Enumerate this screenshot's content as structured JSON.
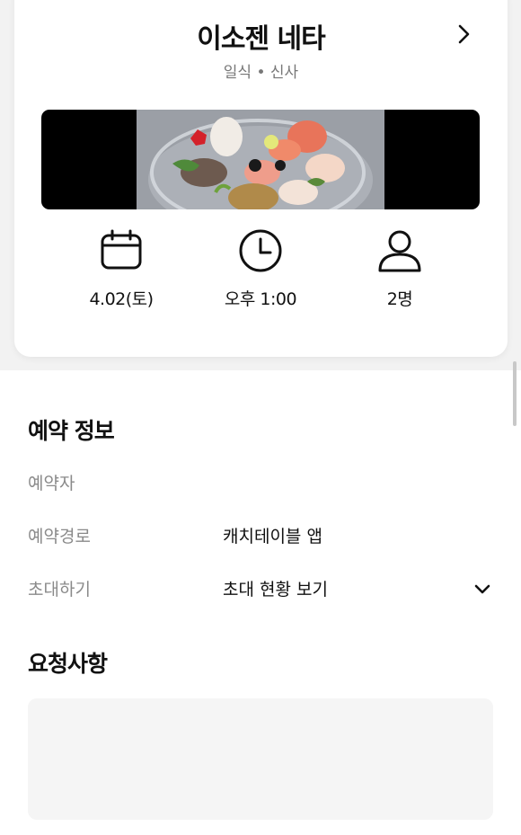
{
  "restaurant": {
    "name": "이소젠 네타",
    "subtitle": "일식 • 신사"
  },
  "reservation_summary": {
    "date": "4.02(토)",
    "time": "오후 1:00",
    "party_size": "2명"
  },
  "reservation_info": {
    "section_title": "예약 정보",
    "rows": [
      {
        "label": "예약자",
        "value": ""
      },
      {
        "label": "예약경로",
        "value": "캐치테이블 앱"
      },
      {
        "label": "초대하기",
        "value": "초대 현황 보기"
      }
    ]
  },
  "requests": {
    "section_title": "요청사항",
    "content": ""
  },
  "icons": {
    "header_arrow": "chevron-right-icon",
    "date": "calendar-icon",
    "time": "clock-icon",
    "party": "person-icon",
    "invite_toggle": "chevron-down-icon"
  },
  "colors": {
    "background_top": "#f2f2f2",
    "card": "#ffffff",
    "secondary_text": "#8a8a8a",
    "request_box": "#f5f5f5"
  }
}
